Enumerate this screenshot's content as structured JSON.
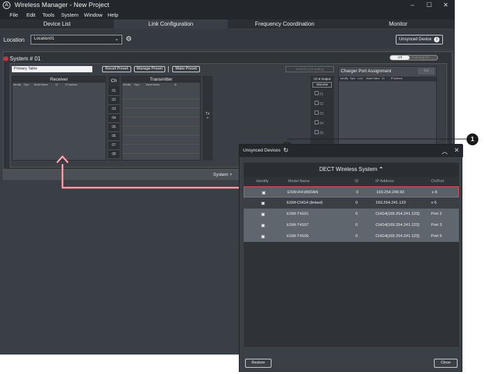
{
  "window": {
    "title": "Wireless Manager - New Project",
    "minimize": "–",
    "maximize": "☐",
    "close": "✕"
  },
  "menu": [
    "File",
    "Edit",
    "Tools",
    "System",
    "Window",
    "Help"
  ],
  "tabs": [
    "Device List",
    "Link Configuration",
    "Frequency Coordination",
    "Monitor"
  ],
  "location": {
    "label": "Location",
    "value": "Location01",
    "unsynced_label": "Unsynced Device"
  },
  "system": {
    "name": "System # 01",
    "toggle_off": "Off",
    "toggle_on": "Roaming On",
    "table_name": "Primary Table",
    "buttons": {
      "recall": "Recall Preset",
      "manage": "Manage Preset",
      "make": "Make Preset",
      "refresh": "Refresh Link Setting"
    },
    "receiver_title": "Receiver",
    "ch_title": "Ch",
    "transmitter_title": "Transmitter",
    "rx_cols": [
      "Identify",
      "Sync",
      "Model Name",
      "ID",
      "IP Address"
    ],
    "tx_cols": [
      "Identify",
      "Sync",
      "Model Name",
      "ID"
    ],
    "channels": [
      "01",
      "02",
      "03",
      "04",
      "05",
      "06",
      "07",
      "08"
    ],
    "tx_plus": "Tx\n+",
    "ch_output_title": "Ch 8 Output",
    "ch_output_mode": "Discrete",
    "ch_outputs": [
      "01",
      "02",
      "03",
      "04",
      "05"
    ],
    "charger_title": "Charger Port Assignment",
    "charger_set": "Set",
    "charger_cols": [
      "Identify",
      "Sync",
      "Lock",
      "Model Name",
      "ID",
      "IP Address"
    ],
    "system_add": "System +"
  },
  "popup": {
    "title": "Unsynced Devices",
    "group_title": "DECT Wireless System",
    "columns": [
      "Identify",
      "Model Name",
      "ID",
      "IP Address",
      "Ch/Port"
    ],
    "rows": [
      {
        "model": "ESW-R4180DAN",
        "id": "0",
        "ip": "169.254.249.93",
        "port": "x 8"
      },
      {
        "model": "ESW-CHG4 (linked)",
        "id": "0",
        "ip": "169.254.241.123",
        "port": "x 6"
      },
      {
        "model": "ESW-T4101",
        "id": "0",
        "ip": "CHG4[169.254.241.123]",
        "port": "Port 2"
      },
      {
        "model": "ESW-T4107",
        "id": "0",
        "ip": "CHG4[169.254.241.123]",
        "port": "Port 3"
      },
      {
        "model": "ESW-T4106",
        "id": "0",
        "ip": "CHG4[169.254.241.123]",
        "port": "Port 5"
      }
    ],
    "restore": "Restore",
    "close": "Close"
  },
  "callout": "1",
  "colors": {
    "highlight": "#e04a5a",
    "accent_red": "#c8323c"
  }
}
